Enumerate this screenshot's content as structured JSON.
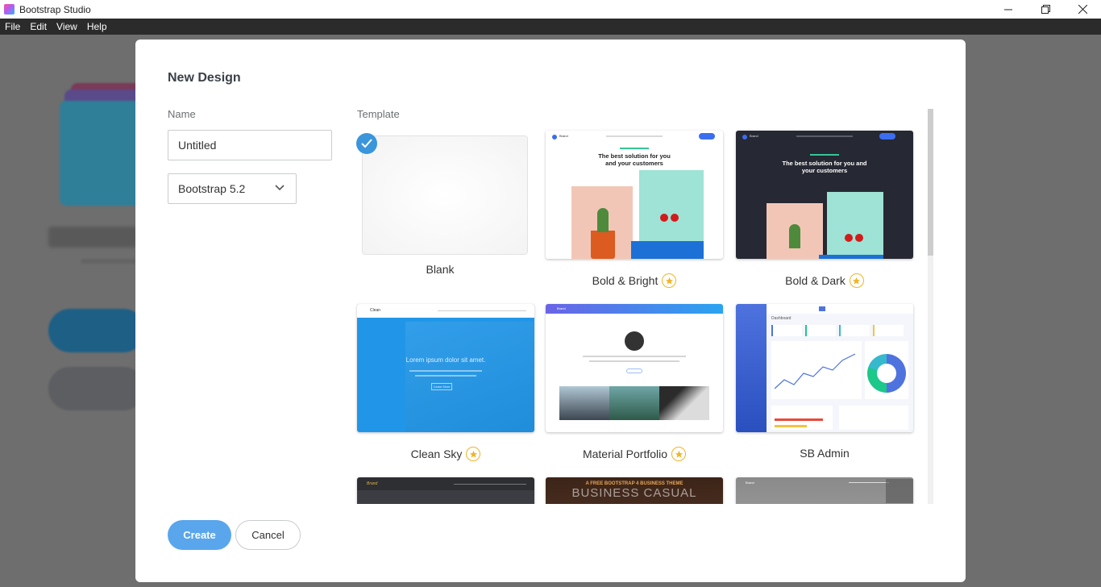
{
  "window": {
    "title": "Bootstrap Studio",
    "minimize_icon": "minimize-icon",
    "maximize_icon": "restore-icon",
    "close_icon": "close-icon"
  },
  "menu": {
    "items": [
      "File",
      "Edit",
      "View",
      "Help"
    ]
  },
  "dialog": {
    "title": "New Design",
    "name_label": "Name",
    "name_value": "Untitled",
    "version_value": "Bootstrap 5.2",
    "template_label": "Template",
    "create_label": "Create",
    "cancel_label": "Cancel",
    "accent_color": "#5aa6ec",
    "star_color": "#f0b429"
  },
  "templates": [
    {
      "label": "Blank",
      "selected": true,
      "premium": false
    },
    {
      "label": "Bold & Bright",
      "selected": false,
      "premium": true,
      "preview": {
        "heading": "The best solution for you and your customers",
        "brand": "Brand"
      }
    },
    {
      "label": "Bold & Dark",
      "selected": false,
      "premium": true,
      "preview": {
        "heading": "The best solution for you and your customers",
        "brand": "Brand"
      }
    },
    {
      "label": "Clean Sky",
      "selected": false,
      "premium": true,
      "preview": {
        "brand": "Clean",
        "heading": "Lorem ipsum dolor sit amet.",
        "button": "Learn More"
      }
    },
    {
      "label": "Material Portfolio",
      "selected": false,
      "premium": true,
      "preview": {
        "brand": "Brand"
      }
    },
    {
      "label": "SB Admin",
      "selected": false,
      "premium": false,
      "preview": {
        "heading": "Dashboard"
      }
    },
    {
      "label": "",
      "selected": false,
      "premium": false,
      "preview": {
        "brand": "Brand"
      }
    },
    {
      "label": "",
      "selected": false,
      "premium": false,
      "preview": {
        "tagline": "A FREE BOOTSTRAP 4 BUSINESS THEME",
        "heading": "BUSINESS CASUAL"
      }
    },
    {
      "label": "",
      "selected": false,
      "premium": false,
      "preview": {
        "brand": "Brand"
      }
    }
  ]
}
